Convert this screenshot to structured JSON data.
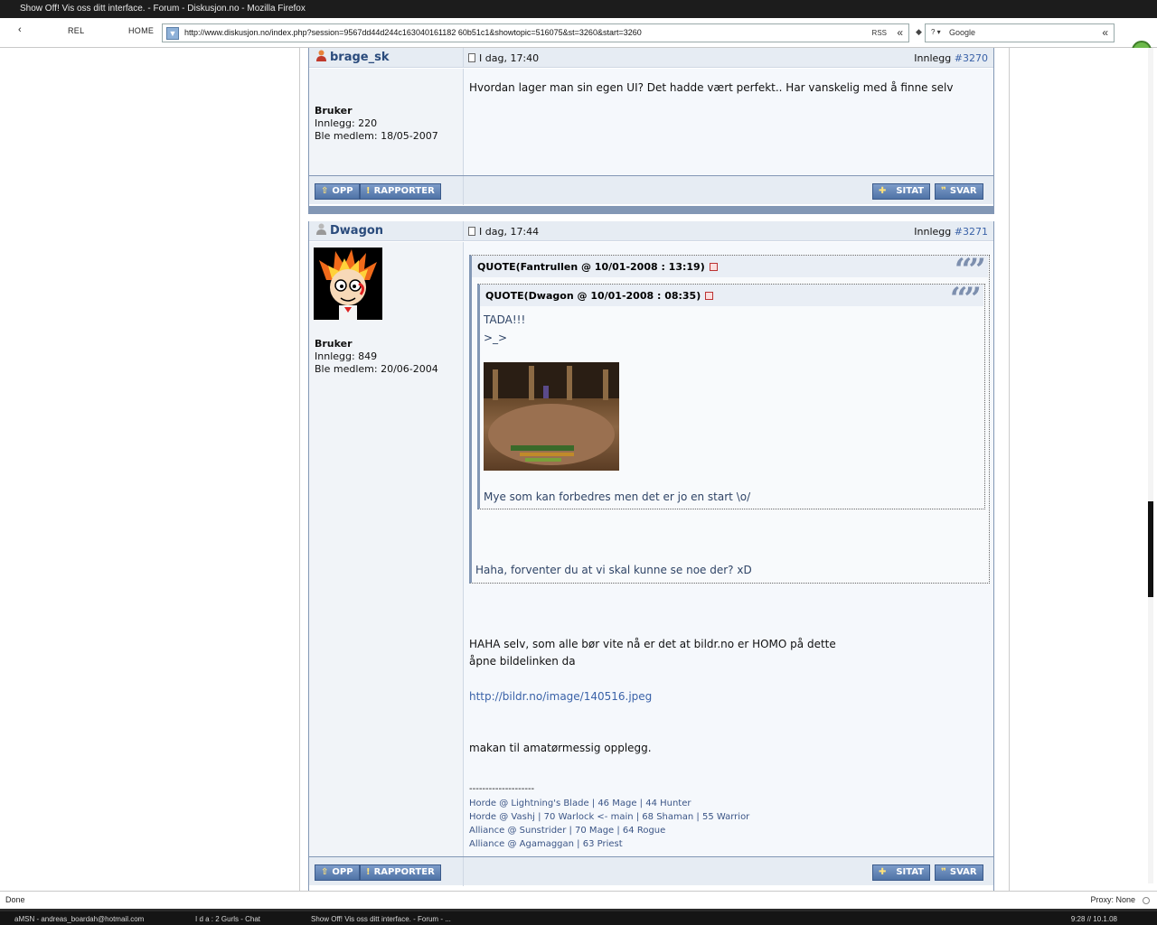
{
  "window": {
    "title": "Show Off! Vis oss ditt interface. - Forum - Diskusjon.no - Mozilla Firefox"
  },
  "toolbar": {
    "back_label": "‹",
    "reload_label": "REL",
    "home_label": "HOME",
    "url": "http://www.diskusjon.no/index.php?session=9567dd44d244c163040161182 60b51c1&showtopic=516075&st=3260&start=3260",
    "rss_label": "RSS",
    "url_go_label": "«",
    "search_engine_label": "? ▾",
    "search_placeholder": "Google",
    "search_go_label": "«"
  },
  "posts": [
    {
      "author": "brage_sk",
      "date": "I dag, 17:40",
      "postno_prefix": "Innlegg ",
      "postno": "#3270",
      "group": "Bruker",
      "posts_count": "Innlegg: 220",
      "joined": "Ble medlem: 18/05-2007",
      "body": "Hvordan lager man sin egen UI? Det hadde vært perfekt.. Har vanskelig med å finne selv"
    },
    {
      "author": "Dwagon",
      "date": "I dag, 17:44",
      "postno_prefix": "Innlegg ",
      "postno": "#3271",
      "group": "Bruker",
      "posts_count": "Innlegg: 849",
      "joined": "Ble medlem: 20/06-2004",
      "quote_outer_title": "QUOTE(Fantrullen @ 10/01-2008 : 13:19)",
      "quote_inner_title": "QUOTE(Dwagon @ 10/01-2008 : 08:35)",
      "quote_inner_line1": "TADA!!!",
      "quote_inner_line2": ">_>",
      "quote_inner_line3": "Mye som kan forbedres men det er jo en start \\o/",
      "quote_outer_text": "Haha, forventer du at vi skal kunne se noe der? xD",
      "body_line1": "HAHA selv, som alle bør vite nå er det at bildr.no er HOMO på dette",
      "body_line2": "åpne bildelinken da",
      "body_link": "http://bildr.no/image/140516.jpeg",
      "body_line3": "makan til amatørmessig opplegg.",
      "sig_rule": "--------------------",
      "sig_lines": [
        "Horde @ Lightning's Blade | 46 Mage | 44 Hunter",
        "Horde @ Vashj | 70 Warlock <- main | 68 Shaman | 55 Warrior",
        "Alliance @ Sunstrider | 70 Mage | 64 Rogue",
        "Alliance @ Agamaggan | 63 Priest"
      ]
    }
  ],
  "buttons": {
    "up": "OPP",
    "report": "RAPPORTER",
    "quote": "SITAT",
    "reply": "SVAR"
  },
  "status": {
    "text": "Done",
    "proxy": "Proxy: None"
  },
  "taskbar": {
    "items": [
      "aMSN - andreas_boardah@hotmail.com",
      "I d a : 2 Gurls - Chat",
      "Show Off! Vis oss ditt interface. - Forum - ..."
    ],
    "clock": "9:28 // 10.1.08"
  }
}
